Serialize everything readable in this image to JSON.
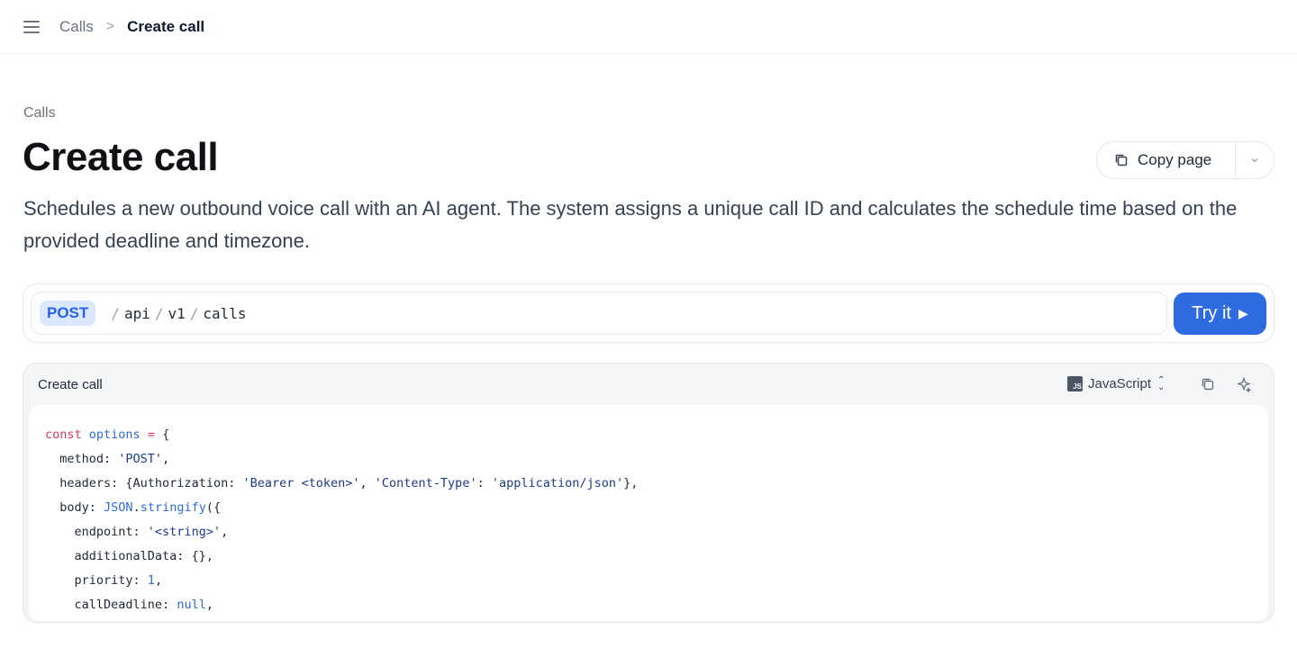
{
  "breadcrumb": {
    "parent": "Calls",
    "separator": ">",
    "current": "Create call"
  },
  "header": {
    "eyebrow": "Calls",
    "title": "Create call",
    "copy_label": "Copy page",
    "description": "Schedules a new outbound voice call with an AI agent. The system assigns a unique call ID and calculates the schedule time based on the provided deadline and timezone."
  },
  "endpoint": {
    "method": "POST",
    "segments": [
      "api",
      "v1",
      "calls"
    ],
    "try_label": "Try it",
    "try_icon": "play-icon"
  },
  "code_panel": {
    "title": "Create call",
    "language": "JavaScript",
    "language_icon": "js-icon",
    "lines": {
      "l1": {
        "kw": "const",
        "name": "options",
        "op": "=",
        "rest": "{"
      },
      "l2": {
        "key": "method: ",
        "str": "'POST'",
        "rest": ","
      },
      "l3": {
        "key": "headers: {Authorization: ",
        "s1": "'Bearer <token>'",
        "mid": ", ",
        "s2": "'Content-Type'",
        "colon": ": ",
        "s3": "'application/json'",
        "rest": "},"
      },
      "l4": {
        "key": "body: ",
        "obj": "JSON",
        "dot": ".",
        "fn": "stringify",
        "rest": "({"
      },
      "l5": {
        "key": "endpoint: ",
        "str": "'<string>'",
        "rest": ","
      },
      "l6": {
        "key": "additionalData: {},"
      },
      "l7": {
        "key": "priority: ",
        "num": "1",
        "rest": ","
      },
      "l8": {
        "key": "callDeadline: ",
        "num": "null",
        "rest": ","
      }
    }
  },
  "colors": {
    "accent": "#2f6be0",
    "method_bg": "#dbe7fd",
    "keyword": "#d83a5b"
  }
}
